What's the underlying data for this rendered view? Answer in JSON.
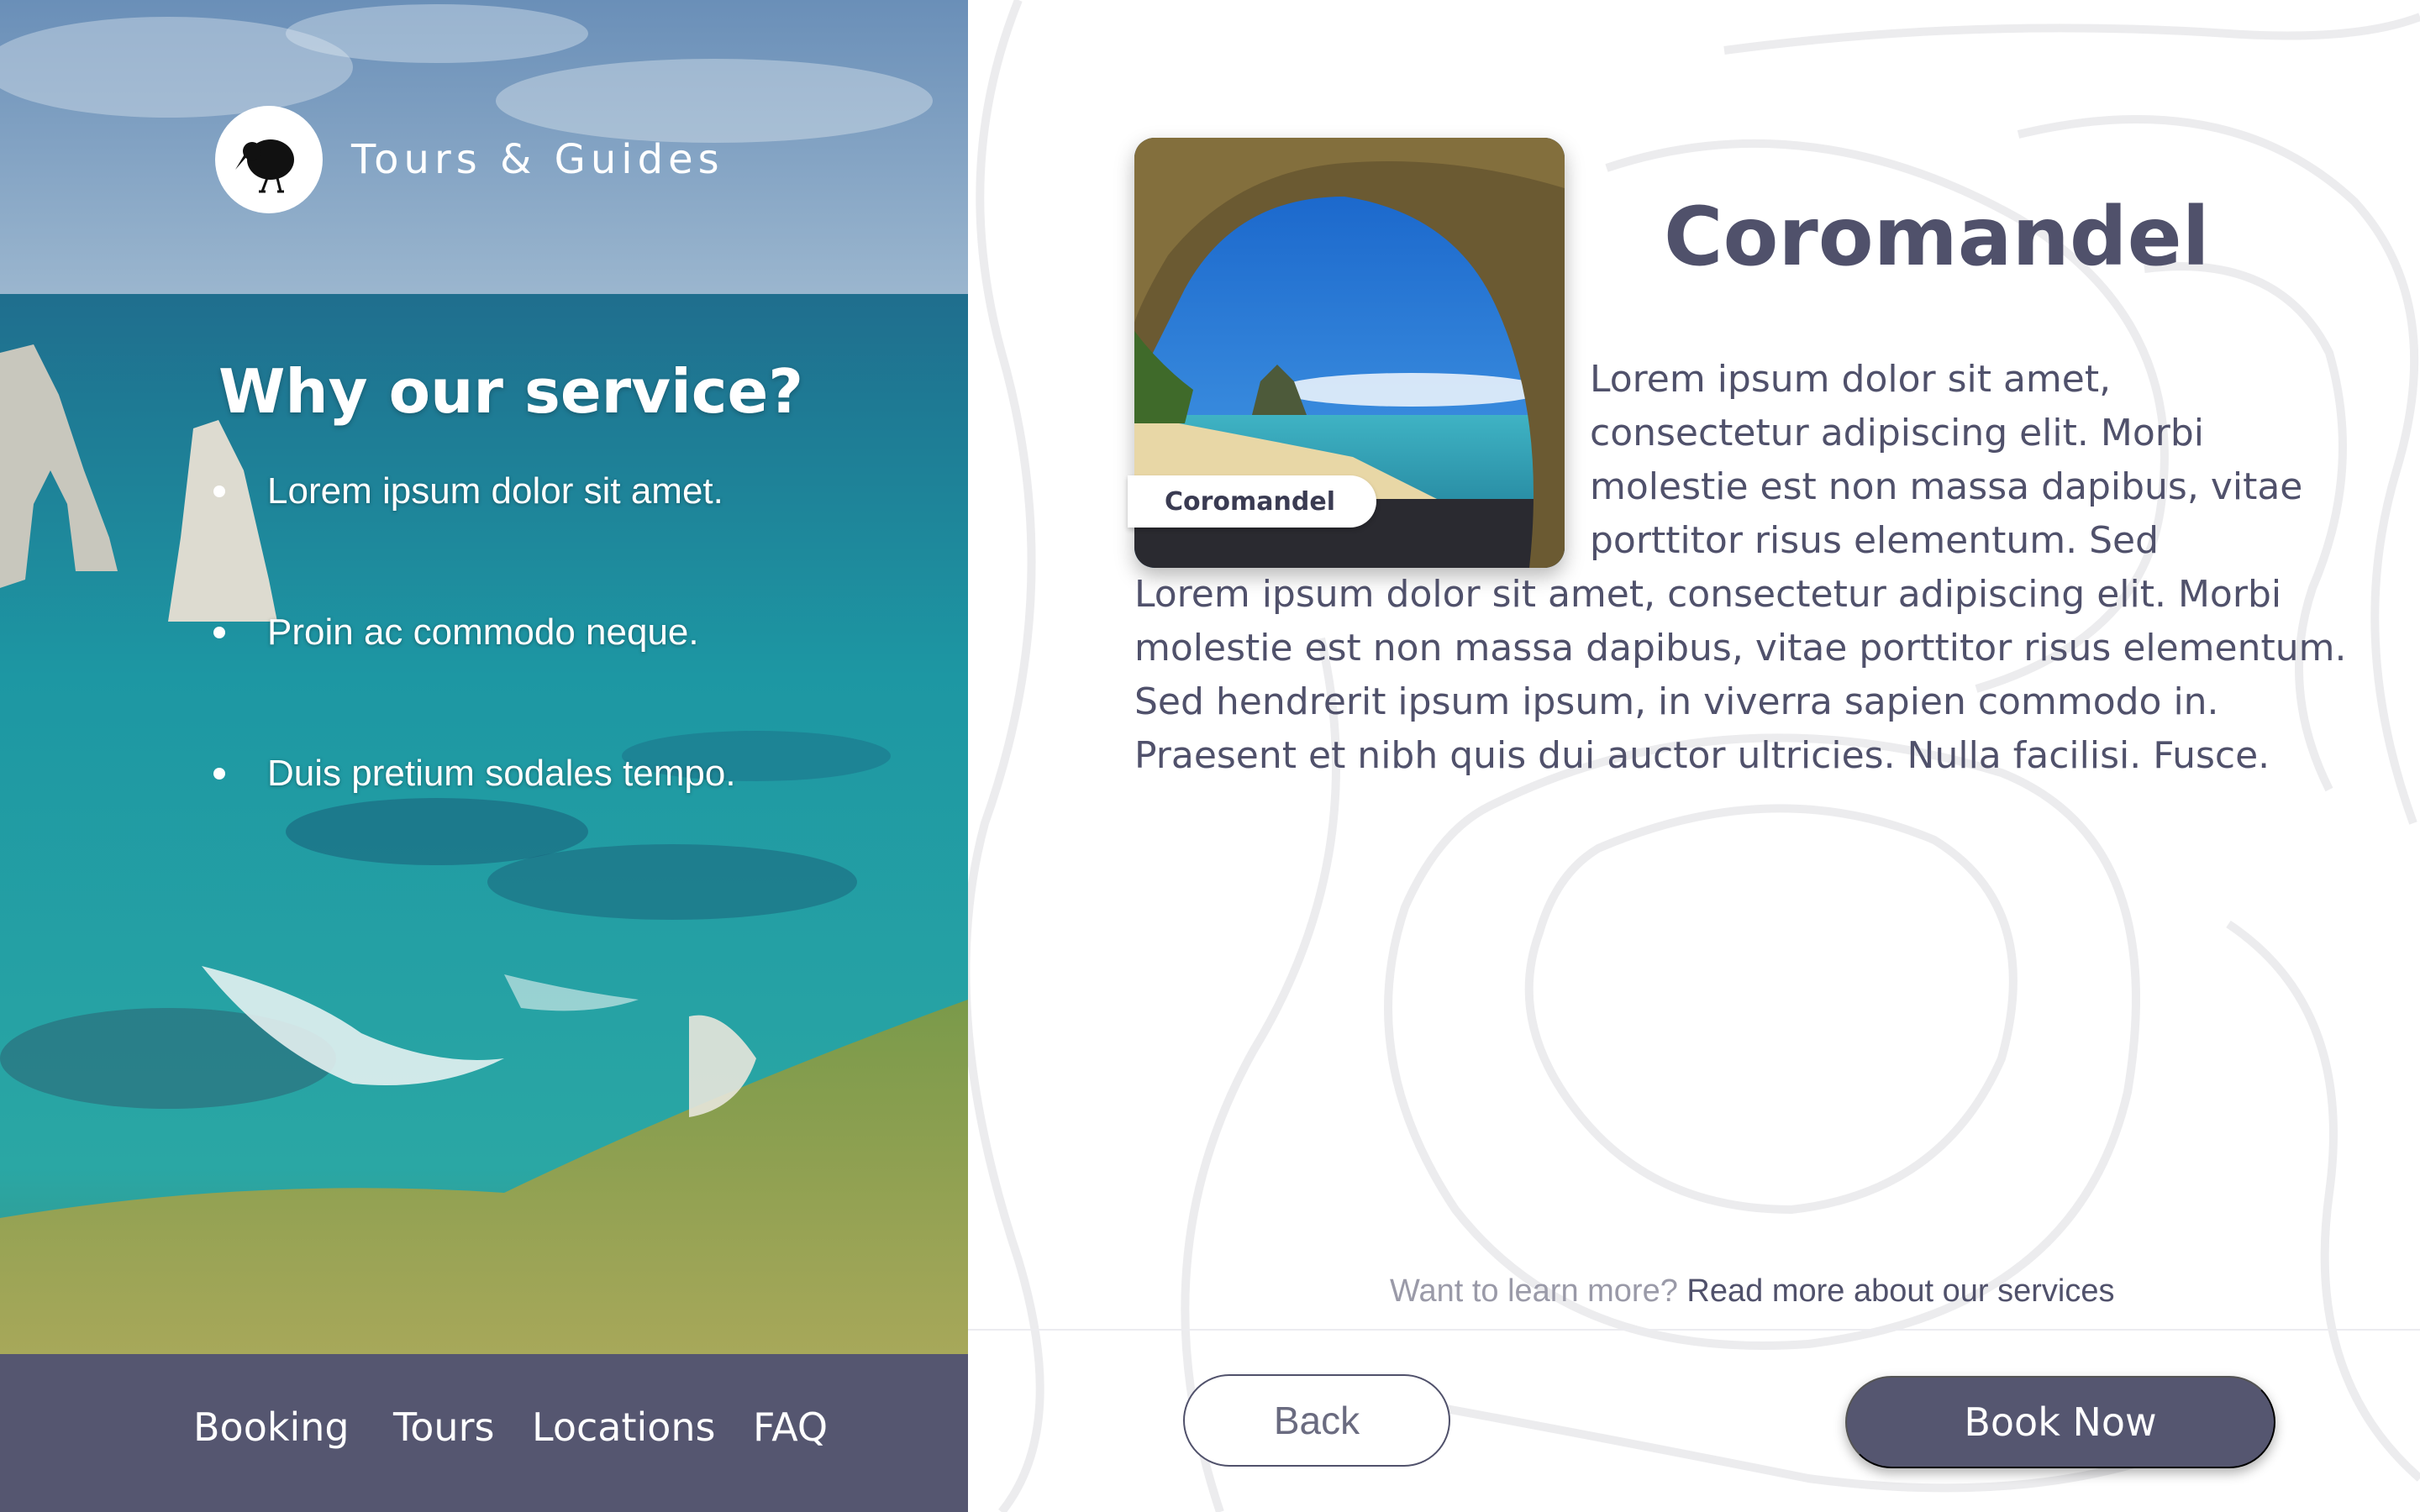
{
  "brand": {
    "name": "Tours & Guides",
    "logo_icon": "kiwi-bird-icon"
  },
  "why": {
    "title": "Why our service?",
    "bullets": [
      "Lorem ipsum dolor sit amet.",
      "Proin ac commodo neque.",
      "Duis pretium sodales tempo."
    ]
  },
  "nav": {
    "items": [
      "Booking",
      "Tours",
      "Locations",
      "FAQ"
    ]
  },
  "destination": {
    "title": "Coromandel",
    "card_label": "Coromandel",
    "desc_lines": [
      "Lorem ipsum dolor sit amet,",
      "consectetur adipiscing elit. Morbi",
      "molestie est non massa dapibus, vitae",
      "porttitor risus elementum. Sed",
      "Lorem ipsum dolor sit amet, consectetur adipiscing elit. Morbi",
      "molestie est non massa dapibus, vitae porttitor risus elementum.",
      "Sed hendrerit ipsum ipsum, in viverra sapien commodo in.",
      "Praesent et nibh quis dui auctor ultricies. Nulla facilisi. Fusce."
    ]
  },
  "learn_more": {
    "prompt": "Want to learn more?",
    "link": "Read more about our services"
  },
  "actions": {
    "back": "Back",
    "book": "Book Now"
  },
  "colors": {
    "primary": "#555670",
    "text": "#50516b",
    "sea": "#1e9aa6"
  }
}
